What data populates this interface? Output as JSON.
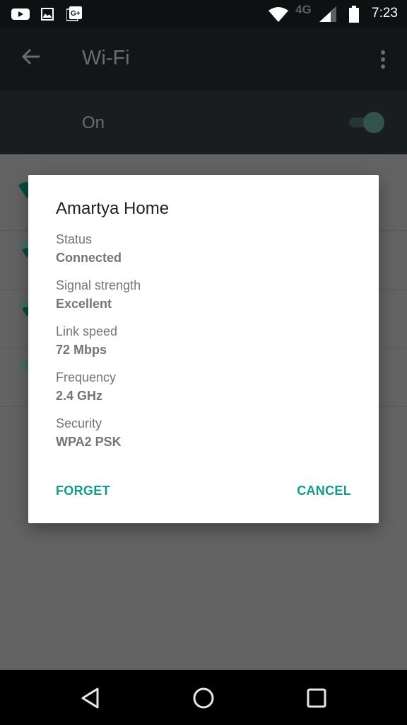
{
  "status_bar": {
    "left_icons": [
      "youtube-icon",
      "gallery-icon",
      "google-plus-icon"
    ],
    "right_icons": [
      "wifi-signal-icon",
      "cellular-signal-icon",
      "battery-icon"
    ],
    "network_type": "4G",
    "time": "7:23"
  },
  "app_bar": {
    "back_icon": "arrow-back-icon",
    "title": "Wi-Fi",
    "menu_icon": "more-vert-icon"
  },
  "wifi_toggle": {
    "label": "On",
    "enabled": true
  },
  "background_list": {
    "item_count": 4
  },
  "dialog": {
    "title": "Amartya Home",
    "fields": [
      {
        "label": "Status",
        "value": "Connected"
      },
      {
        "label": "Signal strength",
        "value": "Excellent"
      },
      {
        "label": "Link speed",
        "value": "72 Mbps"
      },
      {
        "label": "Frequency",
        "value": "2.4 GHz"
      },
      {
        "label": "Security",
        "value": "WPA2 PSK"
      }
    ],
    "forget_label": "FORGET",
    "cancel_label": "CANCEL"
  },
  "nav_bar": {
    "back": "nav-back-icon",
    "home": "nav-home-icon",
    "recents": "nav-recents-icon"
  },
  "colors": {
    "accent": "#139a8c",
    "dialog_bg": "#ffffff",
    "scrim": "#636363"
  }
}
